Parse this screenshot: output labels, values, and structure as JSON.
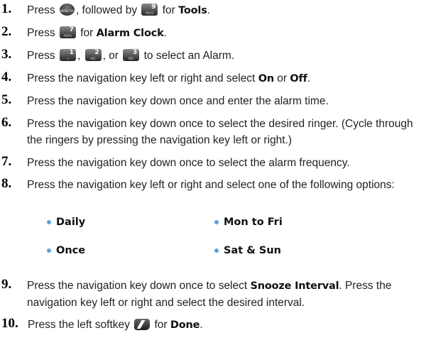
{
  "steps": [
    {
      "num": "1.",
      "parts": {
        "a": "Press",
        "b": ", followed by",
        "c": "for",
        "d": "Tools",
        "e": "."
      },
      "keys": {
        "menu": {
          "label": "MENU OK"
        },
        "nine": {
          "digit": "9",
          "letters": "WXYZ"
        }
      }
    },
    {
      "num": "2.",
      "parts": {
        "a": "Press",
        "b": "for",
        "c": "Alarm Clock",
        "d": "."
      },
      "keys": {
        "seven": {
          "digit": "7",
          "letters": "PQRS"
        }
      }
    },
    {
      "num": "3.",
      "parts": {
        "a": "Press",
        "b": ",",
        "c": ", or",
        "d": "to select an Alarm."
      },
      "keys": {
        "one": {
          "digit": "1",
          "letters": "∞"
        },
        "two": {
          "digit": "2",
          "letters": "ABC"
        },
        "three": {
          "digit": "3",
          "letters": "DEF"
        }
      }
    },
    {
      "num": "4.",
      "parts": {
        "a": "Press the navigation key left or right and select",
        "b": "On",
        "c": "or",
        "d": "Off",
        "e": "."
      }
    },
    {
      "num": "5.",
      "text": "Press the navigation key down once and enter the alarm time."
    },
    {
      "num": "6.",
      "text": "Press the navigation key down once to select the desired ringer. (Cycle through the ringers by pressing the navigation key left or right.)"
    },
    {
      "num": "7.",
      "text": "Press the navigation key down once to select the alarm frequency."
    },
    {
      "num": "8.",
      "text": "Press the navigation key left or right and select one of the following options:"
    },
    {
      "num": "9.",
      "parts": {
        "a": "Press the navigation key down once to select",
        "b": "Snooze Interval",
        "c": ". Press the navigation key left or right and select the desired interval."
      }
    },
    {
      "num": "10.",
      "parts": {
        "a": "Press the left softkey",
        "b": "for",
        "c": "Done",
        "d": "."
      }
    }
  ],
  "options": [
    "Daily",
    "Mon to Fri",
    "Once",
    "Sat & Sun"
  ],
  "colors": {
    "bullet": "#5aa3de",
    "text": "#222222",
    "key_dark": "#262626"
  }
}
